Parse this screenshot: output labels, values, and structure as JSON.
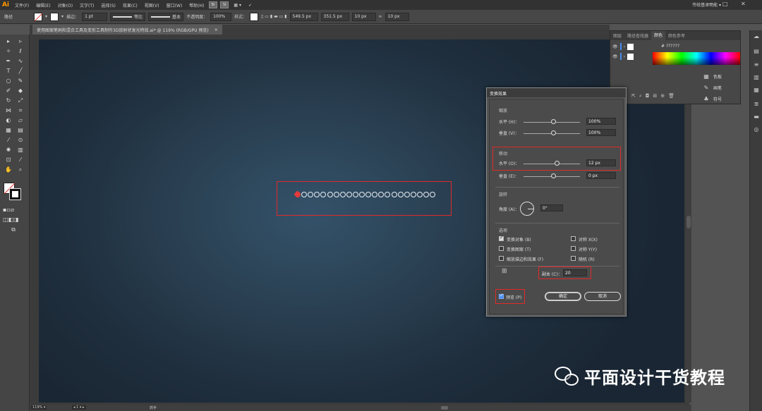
{
  "app": {
    "logo": "Ai"
  },
  "menu": [
    "文件(F)",
    "编辑(E)",
    "对象(O)",
    "文字(T)",
    "选择(S)",
    "效果(C)",
    "视图(V)",
    "窗口(W)",
    "帮助(H)"
  ],
  "menu_buttons": [
    "Br",
    "St"
  ],
  "workspace": "传统基本功能",
  "window_controls": [
    "—",
    "□",
    "✕"
  ],
  "control_bar": {
    "label_path": "路径",
    "stroke_label": "描边：",
    "stroke_value": "1 pt",
    "profile_label": "等比",
    "brush_label": "基本",
    "opacity_label": "不透明度：",
    "opacity_value": "100%",
    "style_label": "样式：",
    "x_value": "549.5 px",
    "y_value": "351.5 px",
    "w_value": "10 px",
    "h_value": "10 px"
  },
  "document_tab": {
    "title": "使用图案笔刷和混合工具及变形工具制作3D放射状发光特效.ai* @ 119% (RGB/GPU 预览)",
    "close": "×"
  },
  "status_bar": {
    "zoom": "119%",
    "page": "1",
    "tool": "抓手"
  },
  "layers_panel": {
    "tabs": [
      "图层",
      "路径查找器",
      "颜色",
      "颜色参考"
    ],
    "active_tab": "颜色",
    "hex": "??????"
  },
  "right_panel_items": [
    {
      "icon": "swatches-icon",
      "label": "色板"
    },
    {
      "icon": "brushes-icon",
      "label": "画笔"
    },
    {
      "icon": "symbols-icon",
      "label": "符号"
    }
  ],
  "dialog": {
    "title": "变换效果",
    "scale_section": "缩放",
    "scale_h_label": "水平 (H)：",
    "scale_h_value": "100%",
    "scale_v_label": "垂直 (V)：",
    "scale_v_value": "100%",
    "move_section": "移动",
    "move_h_label": "水平 (O)：",
    "move_h_value": "12 px",
    "move_v_label": "垂直 (E)：",
    "move_v_value": "0 px",
    "rotate_section": "旋转",
    "angle_label": "角度 (A)：",
    "angle_value": "0°",
    "options_section": "选项",
    "options": [
      {
        "label": "变换对象 (B)",
        "checked": true
      },
      {
        "label": "对称 X(X)",
        "checked": false
      },
      {
        "label": "变换图案 (T)",
        "checked": false
      },
      {
        "label": "对称 Y(Y)",
        "checked": false
      },
      {
        "label": "缩放描边和效果 (F)",
        "checked": false
      },
      {
        "label": "随机 (R)",
        "checked": false
      }
    ],
    "copies_label": "副本 (C)：",
    "copies_value": "20",
    "preview_label": "预览 (P)",
    "preview_checked": true,
    "ok_label": "确定",
    "cancel_label": "取消"
  },
  "artwork": {
    "dot_count": 22,
    "accent_color": "#e53a3a"
  },
  "watermark": "平面设计干货教程"
}
